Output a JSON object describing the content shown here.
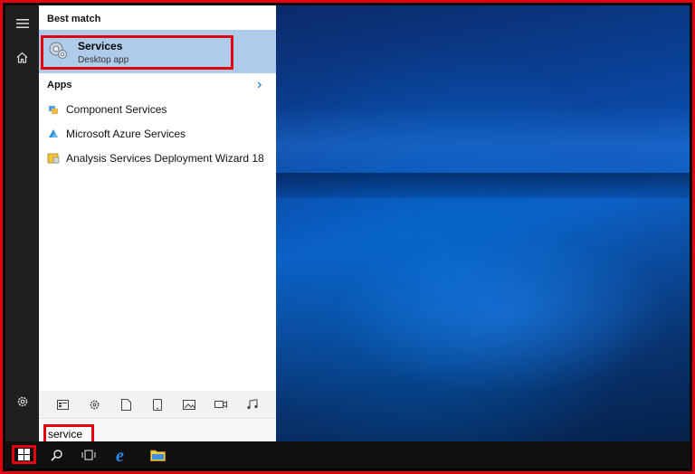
{
  "start_menu": {
    "best_match_label": "Best match",
    "best_match": {
      "title": "Services",
      "subtitle": "Desktop app",
      "icon": "services-gear-icon"
    },
    "apps_label": "Apps",
    "apps": [
      {
        "label": "Component Services",
        "icon": "component-services-icon"
      },
      {
        "label": "Microsoft Azure Services",
        "icon": "azure-icon"
      },
      {
        "label": "Analysis Services Deployment Wizard 18",
        "icon": "wizard-icon"
      }
    ],
    "filters": [
      "apps-filter-icon",
      "settings-filter-icon",
      "documents-filter-icon",
      "tablet-filter-icon",
      "photos-filter-icon",
      "videos-filter-icon",
      "music-filter-icon"
    ],
    "search_value": "service"
  },
  "rail": {
    "icons": [
      "hamburger-icon",
      "home-icon",
      "settings-gear-icon"
    ]
  },
  "taskbar": {
    "icons": [
      "windows-start-icon",
      "search-icon",
      "task-view-icon",
      "edge-icon",
      "file-explorer-icon"
    ]
  },
  "colors": {
    "highlight_red": "#e3000f",
    "selection_blue": "#aecbe9",
    "accent": "#1a6fd0"
  }
}
